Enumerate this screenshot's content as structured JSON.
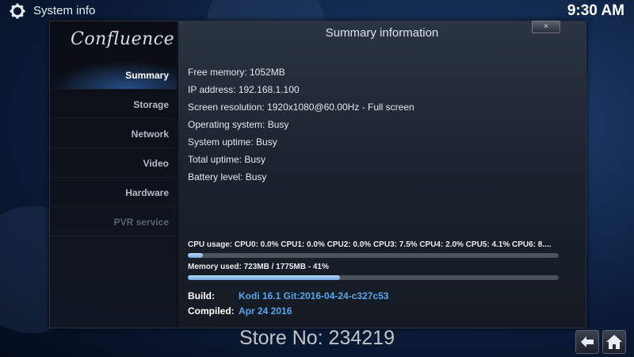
{
  "topbar": {
    "title": "System info",
    "clock": "9:30 AM",
    "icon": "gear-icon"
  },
  "sidebar": {
    "logo": "Confluence",
    "items": [
      {
        "label": "Summary",
        "state": "active"
      },
      {
        "label": "Storage",
        "state": "normal"
      },
      {
        "label": "Network",
        "state": "normal"
      },
      {
        "label": "Video",
        "state": "normal"
      },
      {
        "label": "Hardware",
        "state": "normal"
      },
      {
        "label": "PVR service",
        "state": "disabled"
      }
    ]
  },
  "content": {
    "heading": "Summary information",
    "close_label": "×",
    "info_lines": [
      "Free memory: 1052MB",
      "IP address: 192.168.1.100",
      "Screen resolution: 1920x1080@60.00Hz - Full screen",
      "Operating system: Busy",
      "System uptime: Busy",
      "Total uptime: Busy",
      "Battery level: Busy"
    ],
    "cpu_usage": {
      "label": "CPU usage: CPU0: 0.0% CPU1: 0.0% CPU2: 0.0% CPU3: 7.5% CPU4: 2.0% CPU5: 4.1% CPU6: 8....",
      "percent": 4
    },
    "memory_used": {
      "label": "Memory used: 723MB / 1775MB - 41%",
      "percent": 41
    },
    "build": {
      "label": "Build:",
      "value": "Kodi 16.1 Git:2016-04-24-c327c53"
    },
    "compiled": {
      "label": "Compiled:",
      "value": "Apr 24 2016"
    }
  },
  "footer": {
    "store_text": "Store No: 234219",
    "back_icon": "back-arrow-icon",
    "home_icon": "home-icon"
  },
  "colors": {
    "accent": "#5aa6ee",
    "progress": "#8fc1ee"
  }
}
